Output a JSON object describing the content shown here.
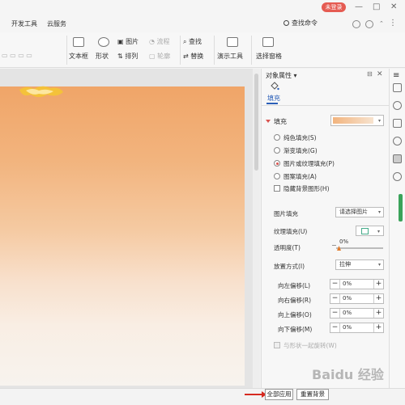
{
  "titlebar": {
    "login_label": "未登录",
    "minimize": "—",
    "restore": "□",
    "close": "✕"
  },
  "menubar": {
    "items": [
      "开发工具",
      "云服务"
    ],
    "search_label": "查找命令"
  },
  "ribbon": {
    "textbox": "文本框",
    "shape": "形状",
    "picture": "图片",
    "arrange": "排列",
    "chart": "流程",
    "outline": "轮廓",
    "find": "查找",
    "replace": "替换",
    "demo_tools": "演示工具",
    "select_pane": "选择窗格"
  },
  "panel": {
    "title": "对象属性",
    "tab_fill": "填充",
    "section_fill": "填充",
    "options": [
      {
        "label": "纯色填充(S)",
        "checked": false
      },
      {
        "label": "渐变填充(G)",
        "checked": false
      },
      {
        "label": "图片或纹理填充(P)",
        "checked": true
      },
      {
        "label": "图案填充(A)",
        "checked": false
      }
    ],
    "hide_bg": "隐藏背景图形(H)",
    "picture_fill_label": "图片填充",
    "picture_fill_value": "请选择图片",
    "texture_fill_label": "纹理填充(U)",
    "transparency_label": "透明度(T)",
    "transparency_value": "0%",
    "placement_label": "放置方式(I)",
    "placement_value": "拉伸",
    "offsets": [
      {
        "label": "向左偏移(L)",
        "value": "0%"
      },
      {
        "label": "向右偏移(R)",
        "value": "0%"
      },
      {
        "label": "向上偏移(O)",
        "value": "0%"
      },
      {
        "label": "向下偏移(M)",
        "value": "0%"
      }
    ],
    "rotate_with_shape": "与形状一起旋转(W)"
  },
  "bottom": {
    "apply_all": "全部应用",
    "reset_bg": "重置背景"
  },
  "watermark": "Baidu 经验",
  "colors": {
    "accent_red": "#e55b52",
    "fill_blue": "#2b5fb8",
    "slide_orange": "#f0a568",
    "arrow_red": "#d62a20"
  }
}
